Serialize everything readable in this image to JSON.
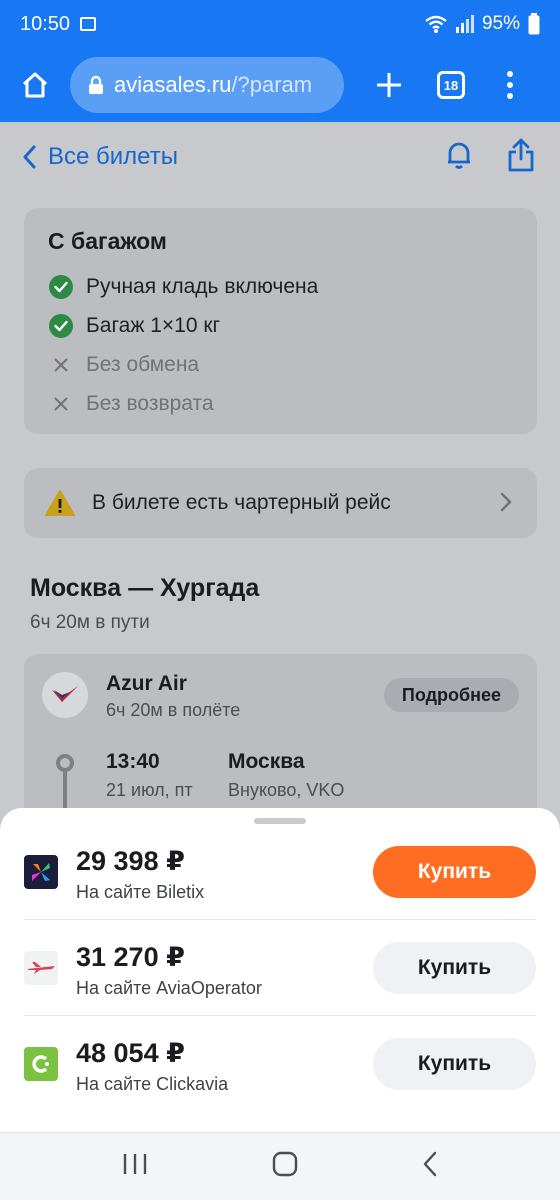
{
  "status_bar": {
    "time": "10:50",
    "battery": "95%"
  },
  "browser": {
    "url_domain": "aviasales.ru",
    "url_rest": "/?param",
    "tab_count": "18"
  },
  "page": {
    "back_label": "Все билеты",
    "baggage": {
      "title": "С багажом",
      "features": [
        {
          "label": "Ручная кладь включена",
          "included": true
        },
        {
          "label": "Багаж 1×10 кг",
          "included": true
        },
        {
          "label": "Без обмена",
          "included": false
        },
        {
          "label": "Без возврата",
          "included": false
        }
      ]
    },
    "charter_notice": "В билете есть чартерный рейс",
    "route": {
      "title": "Москва — Хургада",
      "duration": "6ч 20м в пути"
    },
    "flight": {
      "airline": "Azur Air",
      "flight_duration": "6ч 20м в полёте",
      "details_label": "Подробнее",
      "departure_time": "13:40",
      "departure_date": "21 июл, пт",
      "departure_city": "Москва",
      "departure_airport": "Внуково, VKO"
    }
  },
  "offers": [
    {
      "price": "29 398 ₽",
      "site": "На сайте Biletix",
      "buy_label": "Купить",
      "logo": "biletix-logo"
    },
    {
      "price": "31 270 ₽",
      "site": "На сайте AviaOperator",
      "buy_label": "Купить",
      "logo": "aviaoperator-logo"
    },
    {
      "price": "48 054 ₽",
      "site": "На сайте Clickavia",
      "buy_label": "Купить",
      "logo": "clickavia-logo"
    }
  ],
  "colors": {
    "browser_blue": "#1877f2",
    "link_blue": "#1766cc",
    "buy_orange": "#ff6d22",
    "check_green": "#2c8a44"
  }
}
